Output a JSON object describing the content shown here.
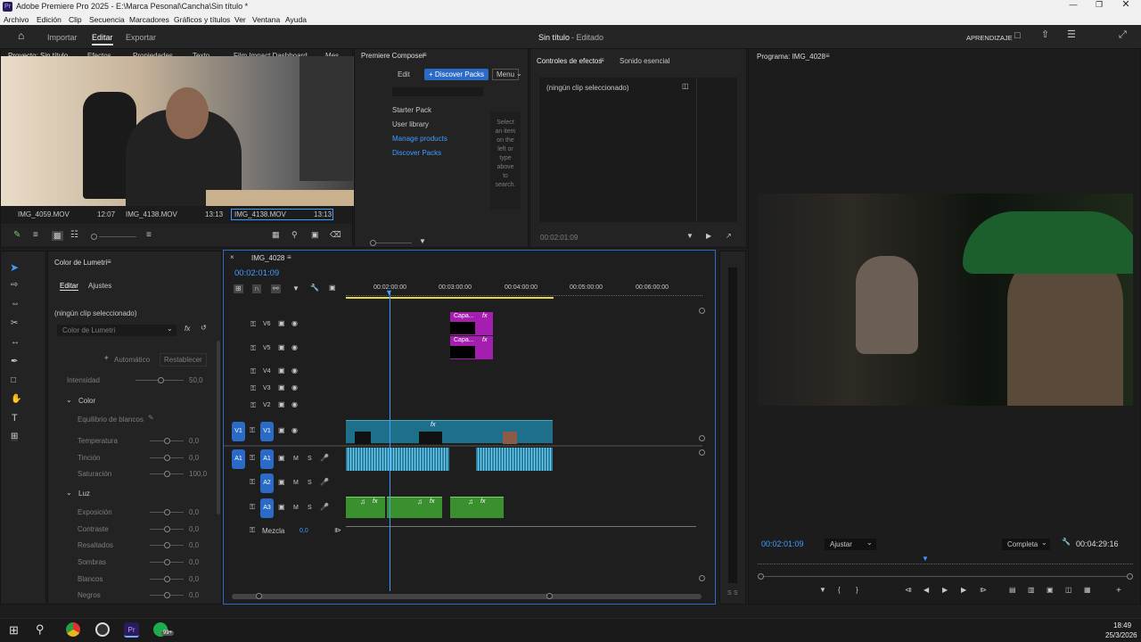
{
  "titlebar": {
    "app_icon": "Pr",
    "title": "Adobe Premiere Pro 2025 - E:\\Marca Pesonal\\Cancha\\Sin título *"
  },
  "menu": [
    "Archivo",
    "Edición",
    "Clip",
    "Secuencia",
    "Marcadores",
    "Gráficos y títulos",
    "Ver",
    "Ventana",
    "Ayuda"
  ],
  "header": {
    "tabs": [
      "Importar",
      "Editar",
      "Exportar"
    ],
    "project_title": "Sin título",
    "project_status": "- Editado",
    "learning": "APRENDIZAJE"
  },
  "project_panel": {
    "tabs": [
      "Proyecto: Sin título",
      "Efectos",
      "Propiedades",
      "Texto",
      "Film Impact Dashboard",
      "Mes"
    ],
    "clips": [
      {
        "name": "IMG_4059.MOV",
        "duration": "12:07"
      },
      {
        "name": "IMG_4138.MOV",
        "duration": "13:13"
      },
      {
        "name": "IMG_4138.MOV",
        "duration": "13:13"
      }
    ]
  },
  "composer": {
    "title": "Premiere Composer",
    "edit_label": "Edit",
    "discover_button": "+ Discover Packs",
    "menu_label": "Menu",
    "items": [
      "Starter Pack",
      "User library",
      "Manage products",
      "Discover Packs"
    ],
    "hint": "Select an item on the left or type above to search."
  },
  "effects_controls": {
    "tabs": [
      "Controles de efectos",
      "Sonido esencial"
    ],
    "no_clip": "(ningún clip seleccionado)",
    "timecode": "00:02:01:09"
  },
  "program": {
    "title": "Programa: IMG_4028",
    "timecode": "00:02:01:09",
    "fit": "Ajustar",
    "quality": "Completa",
    "duration": "00:04:29:16"
  },
  "lumetri": {
    "title": "Color de Lumetri",
    "tabs": [
      "Editar",
      "Ajustes"
    ],
    "no_clip": "(ningún clip seleccionado)",
    "dropdown": "Color de Lumetri",
    "auto_button": "Automático",
    "reset_button": "Restablecer",
    "intensity_label": "Intensidad",
    "intensity_value": "50,0",
    "color_section": "Color",
    "white_balance": "Equilibrio de blancos",
    "color_rows": [
      {
        "label": "Temperatura",
        "value": "0,0"
      },
      {
        "label": "Tinción",
        "value": "0,0"
      },
      {
        "label": "Saturación",
        "value": "100,0"
      }
    ],
    "light_section": "Luz",
    "light_rows": [
      {
        "label": "Exposición",
        "value": "0,0"
      },
      {
        "label": "Contraste",
        "value": "0,0"
      },
      {
        "label": "Resaltados",
        "value": "0,0"
      },
      {
        "label": "Sombras",
        "value": "0,0"
      },
      {
        "label": "Blancos",
        "value": "0,0"
      },
      {
        "label": "Negros",
        "value": "0,0"
      }
    ]
  },
  "timeline": {
    "sequence_name": "IMG_4028",
    "timecode": "00:02:01:09",
    "ruler": [
      "00:02:00:00",
      "00:03:00:00",
      "00:04:00:00",
      "00:05:00:00",
      "00:06:00:00"
    ],
    "video_tracks": [
      "V6",
      "V5",
      "V4",
      "V3",
      "V2",
      "V1"
    ],
    "audio_tracks": [
      "A1",
      "A2",
      "A3"
    ],
    "source_v": "V1",
    "source_a": "A1",
    "mix_label": "Mezcla",
    "mix_value": "0,0",
    "graphic_clip": "Capa...",
    "fx": "fx",
    "m": "M",
    "s": "S"
  },
  "meter": {
    "labels": [
      "S",
      "S"
    ]
  },
  "taskbar": {
    "time": "18:49",
    "date": "25/3/2026",
    "badge": "99+"
  }
}
